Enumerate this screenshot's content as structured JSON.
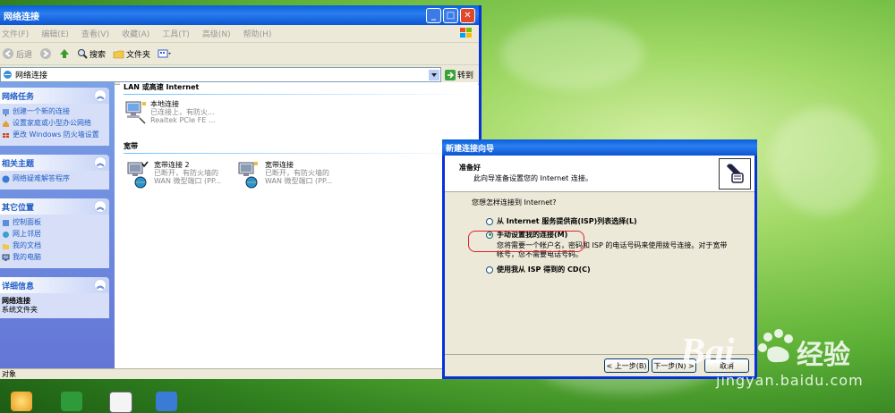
{
  "explorer": {
    "title": "网络连接",
    "menu": [
      "文件(F)",
      "编辑(E)",
      "查看(V)",
      "收藏(A)",
      "工具(T)",
      "高级(N)",
      "帮助(H)"
    ],
    "toolbar": {
      "back": "后退",
      "search": "搜索",
      "folders": "文件夹"
    },
    "address": {
      "value": "网络连接",
      "go_label": "转到"
    },
    "sidebar": {
      "network_tasks": {
        "title": "网络任务",
        "items": [
          "创建一个新的连接",
          "设置家庭或小型办公网络",
          "更改 Windows 防火墙设置"
        ]
      },
      "related": {
        "title": "相关主题",
        "items": [
          "网络疑难解答程序"
        ]
      },
      "other_places": {
        "title": "其它位置",
        "items": [
          "控制面板",
          "网上邻居",
          "我的文档",
          "我的电脑"
        ]
      },
      "details": {
        "title": "详细信息",
        "name": "网络连接",
        "type": "系统文件夹"
      }
    },
    "groups": {
      "lan": {
        "title": "LAN 或高速 Internet",
        "item": {
          "name": "本地连接",
          "status": "已连接上，有防火...",
          "device": "Realtek PCIe FE ..."
        }
      },
      "broadband": {
        "title": "宽带",
        "items": [
          {
            "name": "宽带连接 2",
            "status": "已断开，有防火墙的",
            "device": "WAN 微型端口 (PP..."
          },
          {
            "name": "宽带连接",
            "status": "已断开，有防火墙的",
            "device": "WAN 微型端口 (PP..."
          }
        ]
      }
    },
    "status": "对象"
  },
  "wizard": {
    "title": "新建连接向导",
    "header_title": "准备好",
    "header_sub": "此向导准备设置您的 Internet 连接。",
    "question": "您想怎样连接到 Internet?",
    "options": [
      {
        "label": "从 Internet 服务提供商(ISP)列表选择(L)",
        "selected": false
      },
      {
        "label": "手动设置我的连接(M)",
        "selected": true,
        "desc": "您将需要一个帐户名，密码和 ISP 的电话号码来使用拨号连接。对于宽带帐号，您不需要电话号码。"
      },
      {
        "label": "使用我从 ISP 得到的 CD(C)",
        "selected": false
      }
    ],
    "buttons": {
      "back": "< 上一步(B)",
      "next": "下一步(N) >",
      "cancel": "取消"
    }
  },
  "watermark": {
    "text": "jingyan.baidu.com"
  },
  "colors": {
    "xp_blue": "#0a5fd9",
    "sidebar": "#6375d6",
    "highlight": "#e02030"
  }
}
